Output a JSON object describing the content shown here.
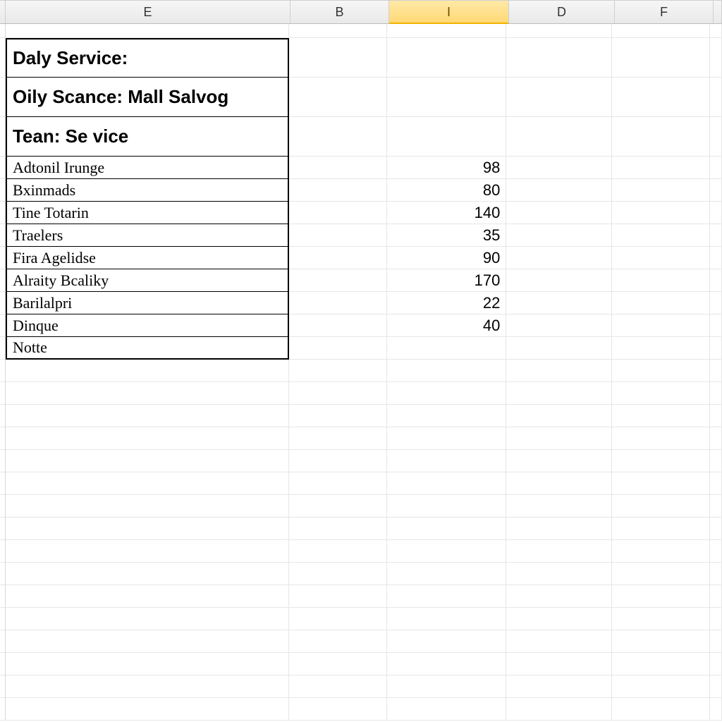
{
  "columns": {
    "E": "E",
    "B": "B",
    "I": "I",
    "D": "D",
    "F": "F"
  },
  "header_block": {
    "line1": "Daly Service:",
    "line2": "Oily Scance: Mall Salvog",
    "line3": "Tean: Se vice"
  },
  "rows": [
    {
      "label": "Adtonil Irunge",
      "value": "98"
    },
    {
      "label": "Bxinmads",
      "value": "80"
    },
    {
      "label": "Tine Totarin",
      "value": "140"
    },
    {
      "label": "Traelers",
      "value": "35"
    },
    {
      "label": "Fira Agelidse",
      "value": "90"
    },
    {
      "label": "Alraity Bcaliky",
      "value": "170"
    },
    {
      "label": "Barilalpri",
      "value": "22"
    },
    {
      "label": "Dinque",
      "value": "40"
    },
    {
      "label": "Notte",
      "value": ""
    }
  ],
  "selected_column": "I"
}
